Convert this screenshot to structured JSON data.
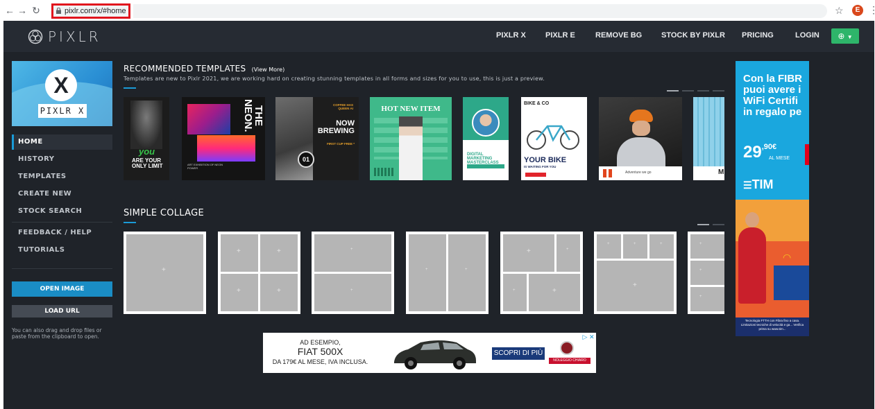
{
  "browser": {
    "url": "pixlr.com/x/#home",
    "profile_initial": "E"
  },
  "topnav": {
    "logo_text": "PIXLR",
    "links": [
      "PIXLR X",
      "PIXLR E",
      "REMOVE BG",
      "STOCK BY PIXLR",
      "PRICING",
      "LOGIN"
    ],
    "language_icon": "globe-icon"
  },
  "sidebar": {
    "brand_letter": "X",
    "brand_label": "PIXLR X",
    "items": [
      "HOME",
      "HISTORY",
      "TEMPLATES",
      "CREATE NEW",
      "STOCK SEARCH",
      "FEEDBACK / HELP",
      "TUTORIALS"
    ],
    "active_item": "HOME",
    "open_image_label": "OPEN IMAGE",
    "load_url_label": "LOAD URL",
    "drag_text": "You can also drag and drop files or paste from the clipboard to open."
  },
  "templates": {
    "title": "RECOMMENDED TEMPLATES",
    "view_more": "(View More)",
    "subtitle": "Templates are new to Pixlr 2021, we are working hard on creating stunning templates in all forms and sizes for you to use, this is just a preview.",
    "cards": [
      {
        "name": "fitness",
        "text": "ARE YOUR ONLY LIMIT",
        "script": "you"
      },
      {
        "name": "neon",
        "text": "THE NEON.",
        "caption": "ART EXHIBITION OF NEON POWER"
      },
      {
        "name": "coffee",
        "text": "NOW BREWING",
        "small": "COFFEE HAS QUEEN AI",
        "sub": "FIRST CUP FREE *",
        "num": "01"
      },
      {
        "name": "hot-new-item",
        "text": "HOT NEW ITEM"
      },
      {
        "name": "digital-marketing",
        "text": "DIGITAL MARKETING MASTERCLASS"
      },
      {
        "name": "bike",
        "text": "YOUR BIKE",
        "brand": "BIKE & CO",
        "sub": "IS WAITING FOR YOU"
      },
      {
        "name": "adventure",
        "text": "Adventure we go"
      },
      {
        "name": "partial",
        "text": "M"
      }
    ]
  },
  "collage": {
    "title": "SIMPLE COLLAGE",
    "plus": "+"
  },
  "ads": {
    "right": {
      "lines": [
        "Con la FIBR",
        "puoi avere i",
        "WiFi Certifi",
        "in regalo pe"
      ],
      "price": "29",
      "price_cents": ",90€",
      "per_month": "AL MESE",
      "brand": "TIM",
      "footer": "Tecnologia FTTH con Fibra fino a casa. Limitazioni tecniche di velocità e ga... Verifica prima su www.tim..."
    },
    "bottom": {
      "line1": "AD ESEMPIO,",
      "line2": "FIAT 500X",
      "line3": "DA 179€ AL MESE, IVA INCLUSA.",
      "cta": "SCOPRI DI PIÙ",
      "rental": "NOLEGGIO CHIARO",
      "choice": "▷ ✕"
    }
  }
}
